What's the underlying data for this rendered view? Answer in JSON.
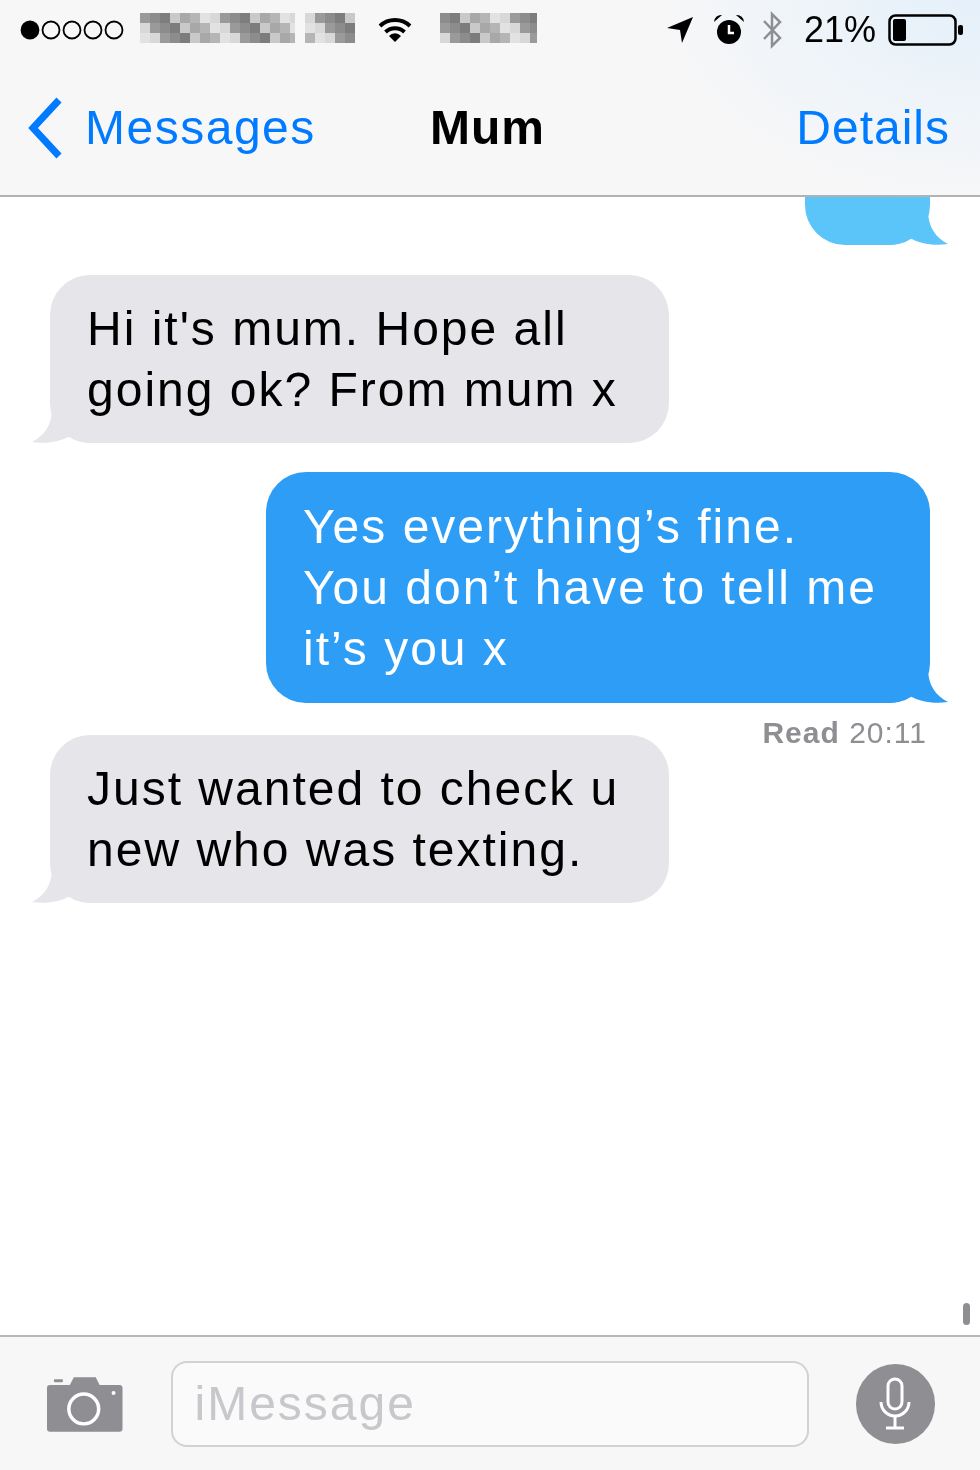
{
  "status_bar": {
    "battery_percent": "21%"
  },
  "nav": {
    "back_label": "Messages",
    "title": "Mum",
    "action": "Details"
  },
  "messages": [
    {
      "kind": "sent_clipped"
    },
    {
      "kind": "received",
      "text": "Hi it's mum. Hope all going ok? From mum x"
    },
    {
      "kind": "sent",
      "text": "Yes everything’s fine.\nYou don’t have to tell me it’s you x",
      "receipt": "**Read** 20:11"
    },
    {
      "kind": "received",
      "text": "Just wanted to check u new who was texting."
    }
  ],
  "composer": {
    "placeholder": "iMessage"
  }
}
